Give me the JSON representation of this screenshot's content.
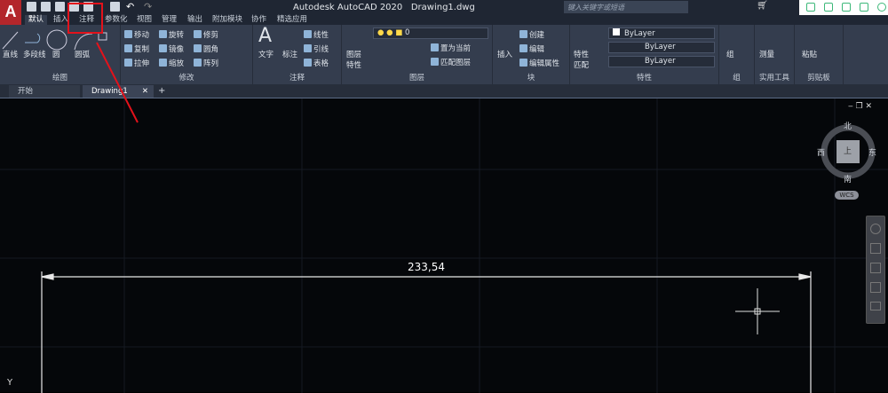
{
  "app": {
    "logo": "A",
    "title": "Autodesk AutoCAD 2020",
    "file": "Drawing1.dwg",
    "search_placeholder": "键入关键字或短语"
  },
  "ribbon_tabs": [
    "默认",
    "插入",
    "注释",
    "参数化",
    "视图",
    "管理",
    "输出",
    "附加模块",
    "协作",
    "精选应用"
  ],
  "panels": {
    "draw": {
      "label": "绘图",
      "items": [
        "直线",
        "多段线",
        "圆",
        "圆弧"
      ]
    },
    "modify": {
      "label": "修改",
      "items": [
        "移动",
        "旋转",
        "修剪",
        "复制",
        "镜像",
        "圆角",
        "拉伸",
        "缩放",
        "阵列"
      ]
    },
    "annotation": {
      "label": "注释",
      "items": [
        "文字",
        "标注",
        "线性",
        "引线",
        "表格"
      ]
    },
    "layers": {
      "label": "图层",
      "layer_value": "0",
      "items": [
        "图层特性",
        "置为当前",
        "匹配图层"
      ]
    },
    "block": {
      "label": "块",
      "items": [
        "插入",
        "创建",
        "编辑",
        "编辑属性"
      ]
    },
    "properties": {
      "label": "特性",
      "match": "特性匹配",
      "color": "ByLayer",
      "linetype": "ByLayer",
      "lineweight": "ByLayer"
    },
    "groups": {
      "label": "组",
      "items": [
        "组"
      ]
    },
    "utilities": {
      "label": "实用工具",
      "items": [
        "测量"
      ]
    },
    "clipboard": {
      "label": "剪贴板",
      "items": [
        "粘贴"
      ]
    }
  },
  "doc_tabs": [
    "开始",
    "Drawing1"
  ],
  "viewcube": {
    "north": "北",
    "south": "南",
    "east": "东",
    "west": "西",
    "top": "上",
    "wcs": "WCS"
  },
  "drawing": {
    "dimension": "233,54",
    "axis_label": "Y"
  },
  "colors": {
    "highlight": "#e3121b",
    "ribbon": "#343d4e",
    "canvas": "#05070a"
  }
}
